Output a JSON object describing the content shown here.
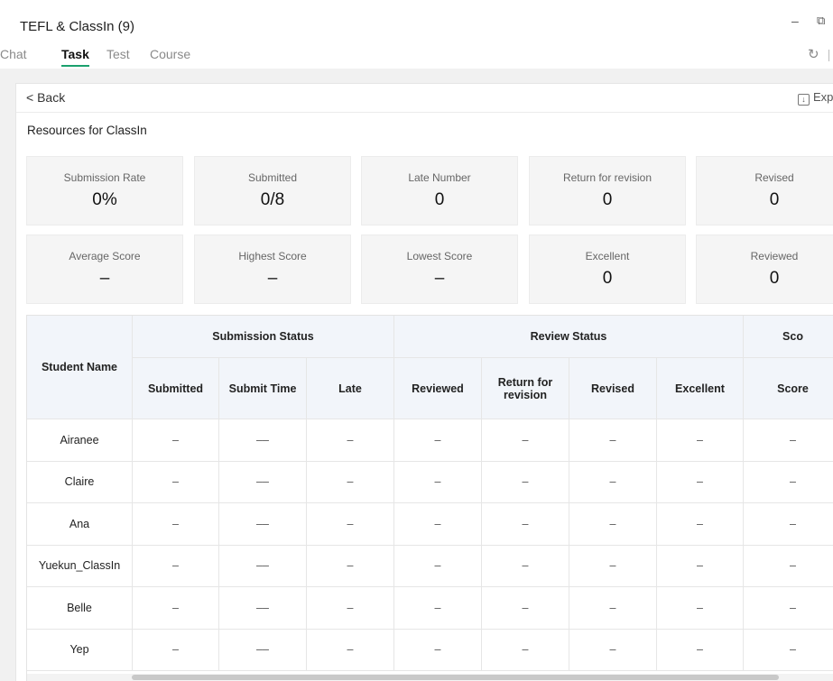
{
  "window": {
    "title": "TEFL & ClassIn (9)",
    "minimize_glyph": "–",
    "restore_glyph": "⧉"
  },
  "tabs": [
    {
      "label": "Chat",
      "active": false
    },
    {
      "label": "Task",
      "active": true
    },
    {
      "label": "Test",
      "active": false
    },
    {
      "label": "Course",
      "active": false
    }
  ],
  "toolbar": {
    "refresh_glyph": "↻",
    "back_label": "< Back",
    "export_label": "Exp",
    "export_glyph": "↓"
  },
  "section_title": "Resources for ClassIn",
  "stats": [
    {
      "label": "Submission Rate",
      "value": "0%"
    },
    {
      "label": "Submitted",
      "value": "0/8"
    },
    {
      "label": "Late Number",
      "value": "0"
    },
    {
      "label": "Return for revision",
      "value": "0"
    },
    {
      "label": "Revised",
      "value": "0"
    },
    {
      "label": "Average Score",
      "value": "–"
    },
    {
      "label": "Highest Score",
      "value": "–"
    },
    {
      "label": "Lowest Score",
      "value": "–"
    },
    {
      "label": "Excellent",
      "value": "0"
    },
    {
      "label": "Reviewed",
      "value": "0"
    }
  ],
  "table": {
    "student_header": "Student Name",
    "groups": [
      "Submission Status",
      "Review Status",
      "Sco"
    ],
    "columns": [
      "Submitted",
      "Submit Time",
      "Late",
      "Reviewed",
      "Return for revision",
      "Revised",
      "Excellent",
      "Score"
    ],
    "rows": [
      {
        "name": "Airanee",
        "cells": [
          "–",
          "––",
          "–",
          "–",
          "–",
          "–",
          "–",
          "–"
        ]
      },
      {
        "name": "Claire",
        "cells": [
          "–",
          "––",
          "–",
          "–",
          "–",
          "–",
          "–",
          "–"
        ]
      },
      {
        "name": "Ana",
        "cells": [
          "–",
          "––",
          "–",
          "–",
          "–",
          "–",
          "–",
          "–"
        ]
      },
      {
        "name": "Yuekun_ClassIn",
        "cells": [
          "–",
          "––",
          "–",
          "–",
          "–",
          "–",
          "–",
          "–"
        ]
      },
      {
        "name": "Belle",
        "cells": [
          "–",
          "––",
          "–",
          "–",
          "–",
          "–",
          "–",
          "–"
        ]
      },
      {
        "name": "Yep",
        "cells": [
          "–",
          "––",
          "–",
          "–",
          "–",
          "–",
          "–",
          "–"
        ]
      }
    ]
  },
  "colors": {
    "accent": "#1aa06d",
    "header_bg": "#f2f5fa",
    "card_bg": "#f5f5f5"
  }
}
